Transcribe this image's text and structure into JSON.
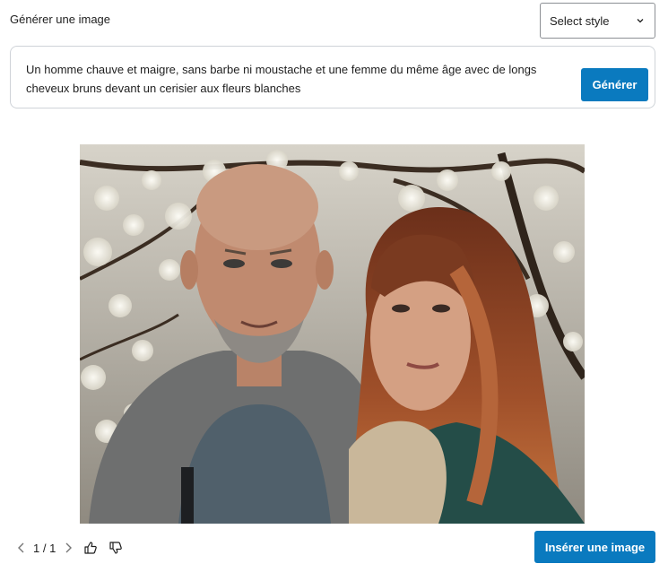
{
  "header": {
    "title": "Générer une image",
    "style_select": {
      "label": "Select style",
      "icon": "chevron-down-icon"
    }
  },
  "prompt": {
    "text": "Un homme chauve et maigre, sans barbe ni moustache et une femme du même âge avec de longs cheveux bruns devant un cerisier aux fleurs blanches",
    "generate_label": "Générer"
  },
  "pager": {
    "counter": "1 / 1",
    "prev_icon": "chevron-left-icon",
    "next_icon": "chevron-right-icon",
    "like_icon": "thumbs-up-icon",
    "dislike_icon": "thumbs-down-icon"
  },
  "actions": {
    "insert_label": "Insérer une image"
  },
  "colors": {
    "primary": "#0a7abf",
    "border": "#cfd3d8",
    "text": "#1e1e1e"
  }
}
